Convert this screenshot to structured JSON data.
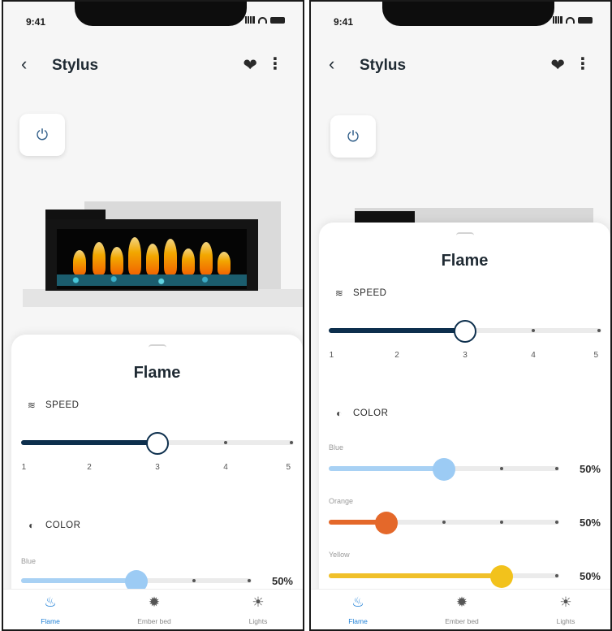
{
  "status": {
    "time": "9:41"
  },
  "header": {
    "title": "Stylus",
    "back_icon": "‹",
    "fav_icon": "❤",
    "more_icon": "⋮"
  },
  "power": {
    "icon": "⏻"
  },
  "sheet": {
    "title": "Flame"
  },
  "speed": {
    "label": "SPEED",
    "icon": "≋",
    "value": 3,
    "ticks": [
      "1",
      "2",
      "3",
      "4",
      "5"
    ],
    "fill_color": "#0d2f4d"
  },
  "color": {
    "label": "COLOR",
    "icon": "◐",
    "channels": [
      {
        "label": "Blue",
        "value": "50%",
        "level": 0.5,
        "color": "#a8d1f4",
        "thumb": "#9ccbf4"
      },
      {
        "label": "Orange",
        "value": "50%",
        "level": 0.25,
        "color": "#e4682a",
        "thumb": "#e4682a"
      },
      {
        "label": "Yellow",
        "value": "50%",
        "level": 0.75,
        "color": "#f0c02a",
        "thumb": "#f2c21c"
      }
    ]
  },
  "tabs": [
    {
      "label": "Flame",
      "icon": "♨",
      "active": true
    },
    {
      "label": "Ember bed",
      "icon": "✹",
      "active": false
    },
    {
      "label": "Lights",
      "icon": "☀",
      "active": false
    }
  ],
  "colors": {
    "accent": "#1d7fd6",
    "dark": "#0d2f4d"
  }
}
